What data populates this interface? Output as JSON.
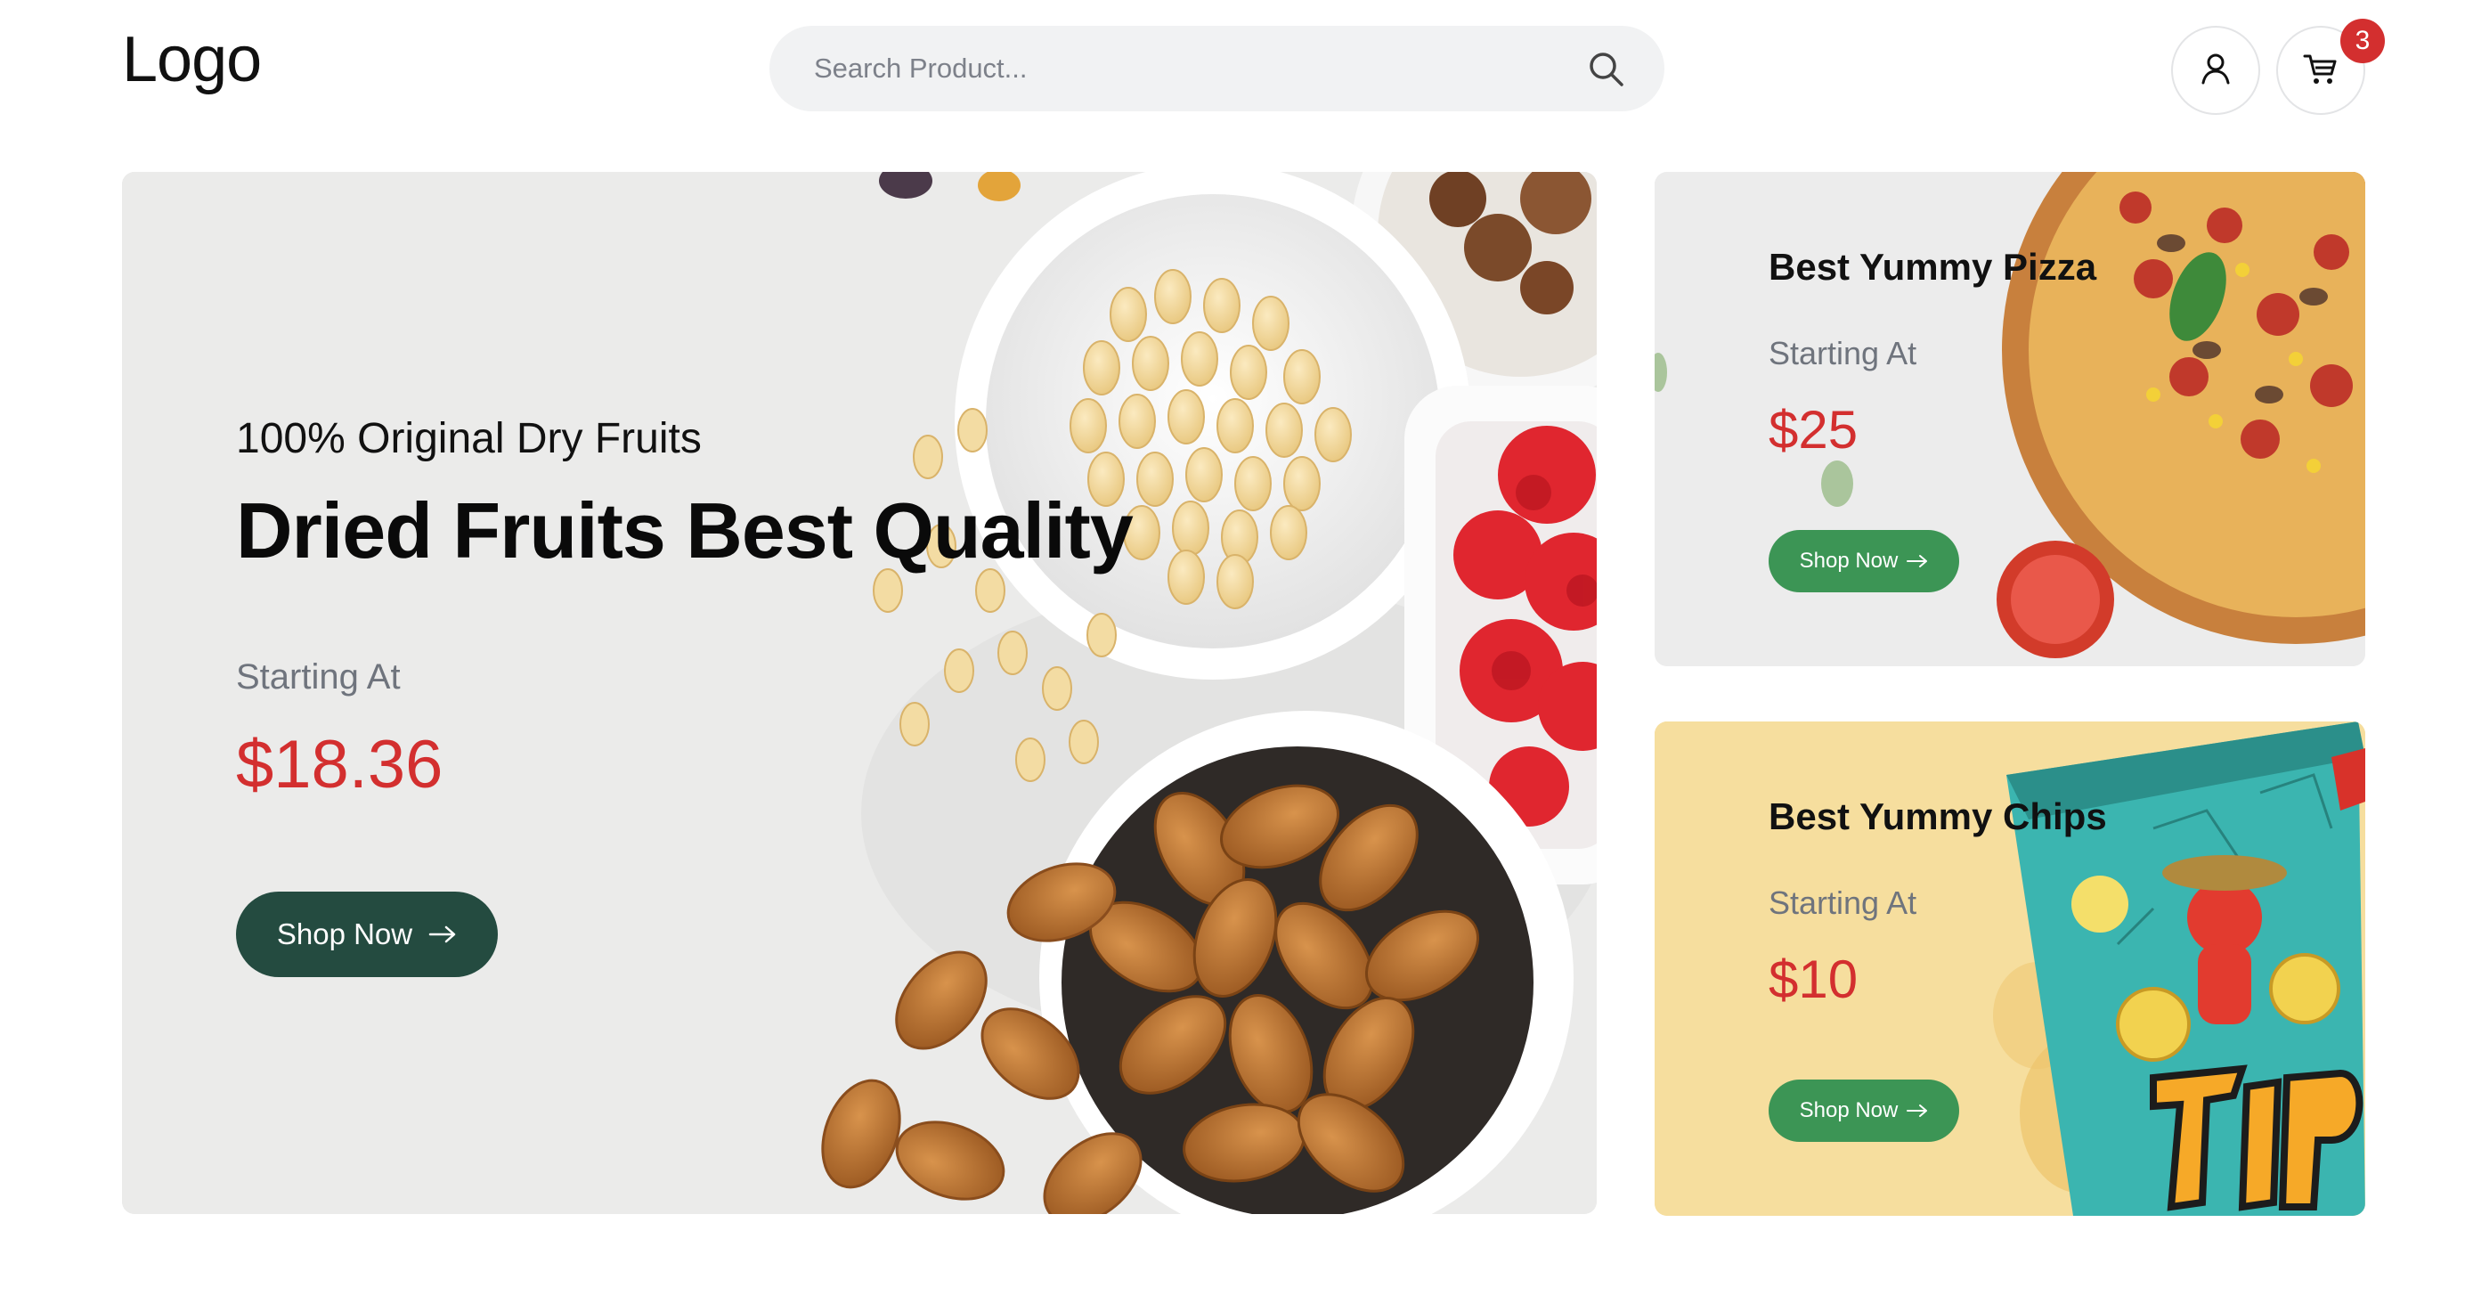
{
  "header": {
    "logo": "Logo",
    "search_placeholder": "Search Product...",
    "cart_count": "3"
  },
  "hero": {
    "eyebrow": "100% Original Dry Fruits",
    "title": "Dried Fruits Best Quality",
    "starting": "Starting At",
    "price": "$18.36",
    "button": "Shop Now"
  },
  "side_banners": [
    {
      "title": "Best Yummy Pizza",
      "starting": "Starting At",
      "price": "$25",
      "button": "Shop Now"
    },
    {
      "title": "Best Yummy Chips",
      "starting": "Starting At",
      "price": "$10",
      "button": "Shop Now"
    }
  ],
  "icons": {
    "search": "search-icon",
    "user": "user-icon",
    "cart": "cart-icon",
    "arrow": "arrow-right-icon"
  },
  "colors": {
    "price": "#d32f2f",
    "hero_button": "#244b40",
    "side_button": "#3c9555",
    "badge": "#d32f2f",
    "chips_background": "#f6de9e"
  }
}
